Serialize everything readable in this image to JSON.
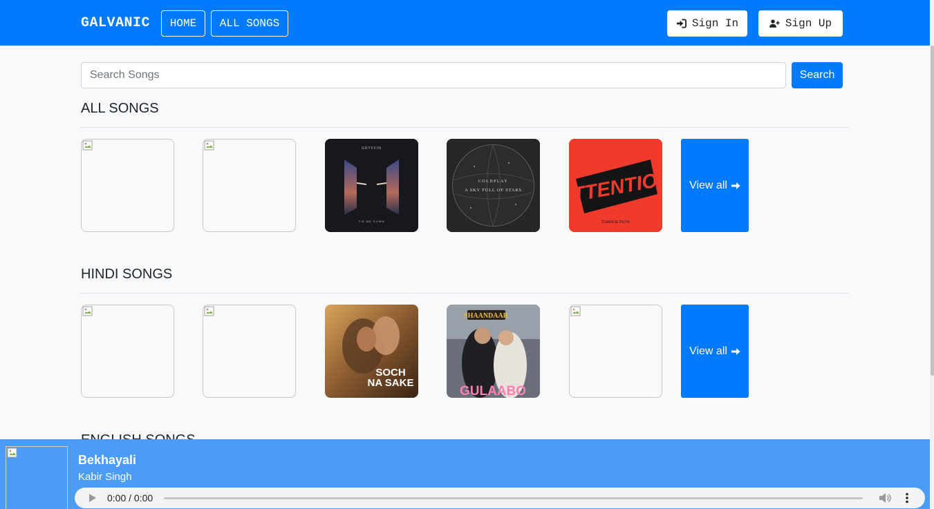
{
  "navbar": {
    "brand": "GALVANIC",
    "home_label": "HOME",
    "all_songs_label": "ALL SONGS",
    "sign_in_label": "Sign In",
    "sign_up_label": "Sign Up",
    "color": "#007bff"
  },
  "search": {
    "placeholder": "Search Songs",
    "value": "",
    "button_label": "Search"
  },
  "sections": [
    {
      "title": "ALL SONGS",
      "view_all_label": "View all",
      "cards": [
        {
          "kind": "broken-image"
        },
        {
          "kind": "broken-image"
        },
        {
          "kind": "album-art",
          "art_text": [
            "GRYFFIN",
            "TIE ME DOWN"
          ]
        },
        {
          "kind": "album-art",
          "art_text": [
            "COLDPLAY",
            "A SKY FULL OF STARS"
          ]
        },
        {
          "kind": "album-art",
          "art_text": [
            "ATTENTION",
            "CHARLIE PUTH"
          ]
        }
      ]
    },
    {
      "title": "HINDI SONGS",
      "view_all_label": "View all",
      "cards": [
        {
          "kind": "broken-image"
        },
        {
          "kind": "broken-image"
        },
        {
          "kind": "album-art",
          "art_text": [
            "SOCH",
            "NA SAKE"
          ]
        },
        {
          "kind": "album-art",
          "art_text": [
            "SHAANDAAR",
            "GULAABO"
          ]
        },
        {
          "kind": "broken-image"
        }
      ]
    },
    {
      "title": "ENGLISH SONGS"
    }
  ],
  "player": {
    "title": "Bekhayali",
    "artist": "Kabir Singh",
    "time": "0:00 / 0:00",
    "progress": 0
  }
}
